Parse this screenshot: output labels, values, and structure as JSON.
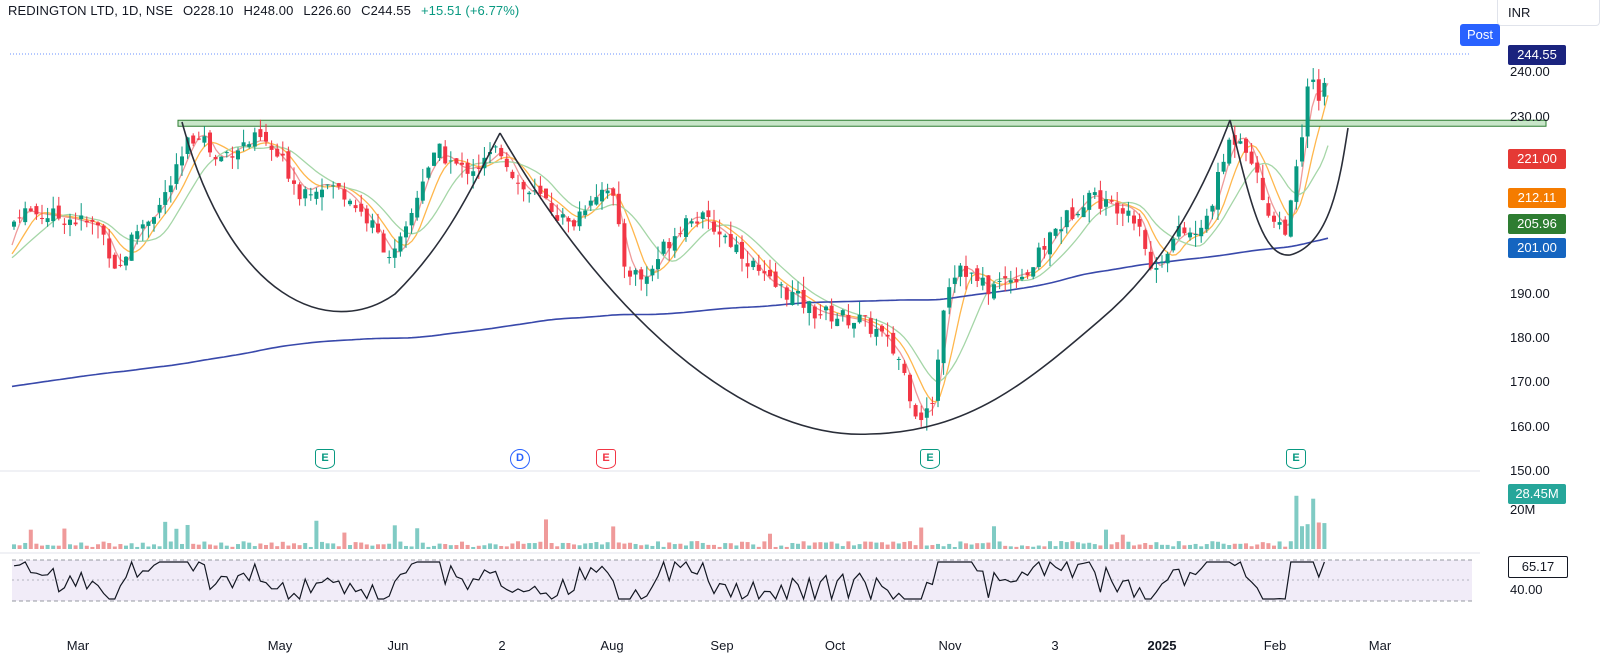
{
  "header": {
    "symbol": "REDINGTON LTD, 1D, NSE",
    "open": "O228.10",
    "high": "H248.00",
    "low": "L226.60",
    "close": "C244.55",
    "change": "+15.51 (+6.77%)"
  },
  "currency_label": "INR",
  "post_label": "Post",
  "price_labels": [
    {
      "text": "244.55",
      "color": "#1a237e"
    },
    {
      "text": "221.00",
      "color": "#e53935"
    },
    {
      "text": "212.11",
      "color": "#f57c00"
    },
    {
      "text": "205.96",
      "color": "#2e7d32"
    },
    {
      "text": "201.00",
      "color": "#1565c0"
    }
  ],
  "volume_label": {
    "text": "28.45M",
    "color": "#26a69a"
  },
  "rsi_label": {
    "text": "65.17",
    "color": "#131722"
  },
  "chart_data": {
    "type": "candlestick",
    "price_axis": {
      "ylim": [
        150,
        250
      ],
      "ticks": [
        "240.00",
        "230.00",
        "190.00",
        "180.00",
        "170.00",
        "160.00",
        "150.00"
      ]
    },
    "volume_axis": {
      "ticks": [
        "20M"
      ]
    },
    "rsi_axis": {
      "ticks": [
        "40.00"
      ],
      "bands": [
        30,
        70
      ]
    },
    "x_ticks": [
      "Mar",
      "May",
      "Jun",
      "2",
      "Aug",
      "Sep",
      "Oct",
      "Nov",
      "3",
      "2025",
      "Feb",
      "Mar"
    ],
    "resistance_level": 228.5,
    "moving_averages": [
      {
        "color": "#ef9a9a",
        "last": 221.0
      },
      {
        "color": "#ffb74d",
        "last": 212.11
      },
      {
        "color": "#a5d6a7",
        "last": 205.96
      },
      {
        "color": "#3949ab",
        "last": 201.0
      }
    ],
    "events": [
      {
        "type": "E",
        "color": "#089981"
      },
      {
        "type": "D",
        "color": "#2962ff"
      },
      {
        "type": "E",
        "color": "#f23645"
      },
      {
        "type": "E",
        "color": "#089981"
      },
      {
        "type": "E",
        "color": "#089981"
      }
    ],
    "closes": [
      [
        0,
        197
      ],
      [
        18,
        209
      ],
      [
        40,
        208
      ],
      [
        70,
        207
      ],
      [
        100,
        205
      ],
      [
        118,
        195
      ],
      [
        135,
        204
      ],
      [
        160,
        210
      ],
      [
        178,
        218
      ],
      [
        188,
        224
      ],
      [
        200,
        227
      ],
      [
        215,
        220
      ],
      [
        235,
        223
      ],
      [
        260,
        225
      ],
      [
        285,
        219
      ],
      [
        300,
        213
      ],
      [
        320,
        215
      ],
      [
        345,
        213
      ],
      [
        370,
        206
      ],
      [
        392,
        198
      ],
      [
        405,
        203
      ],
      [
        425,
        218
      ],
      [
        440,
        222
      ],
      [
        460,
        218
      ],
      [
        480,
        219
      ],
      [
        500,
        223
      ],
      [
        520,
        214
      ],
      [
        545,
        211
      ],
      [
        570,
        205
      ],
      [
        590,
        212
      ],
      [
        610,
        215
      ],
      [
        625,
        196
      ],
      [
        645,
        193
      ],
      [
        665,
        201
      ],
      [
        690,
        208
      ],
      [
        715,
        205
      ],
      [
        740,
        200
      ],
      [
        765,
        193
      ],
      [
        790,
        190
      ],
      [
        815,
        186
      ],
      [
        835,
        185
      ],
      [
        860,
        184
      ],
      [
        880,
        181
      ],
      [
        900,
        175
      ],
      [
        915,
        164
      ],
      [
        925,
        162
      ],
      [
        935,
        168
      ],
      [
        945,
        191
      ],
      [
        960,
        197
      ],
      [
        975,
        193
      ],
      [
        990,
        191
      ],
      [
        1010,
        194
      ],
      [
        1030,
        195
      ],
      [
        1050,
        203
      ],
      [
        1070,
        208
      ],
      [
        1090,
        213
      ],
      [
        1105,
        210
      ],
      [
        1125,
        210
      ],
      [
        1140,
        206
      ],
      [
        1152,
        194
      ],
      [
        1165,
        200
      ],
      [
        1180,
        204
      ],
      [
        1200,
        203
      ],
      [
        1215,
        213
      ],
      [
        1228,
        224
      ],
      [
        1240,
        226
      ],
      [
        1250,
        222
      ],
      [
        1262,
        212
      ],
      [
        1275,
        206
      ],
      [
        1288,
        205
      ],
      [
        1298,
        220
      ],
      [
        1310,
        240
      ],
      [
        1320,
        232
      ],
      [
        1328,
        244.55
      ]
    ]
  }
}
